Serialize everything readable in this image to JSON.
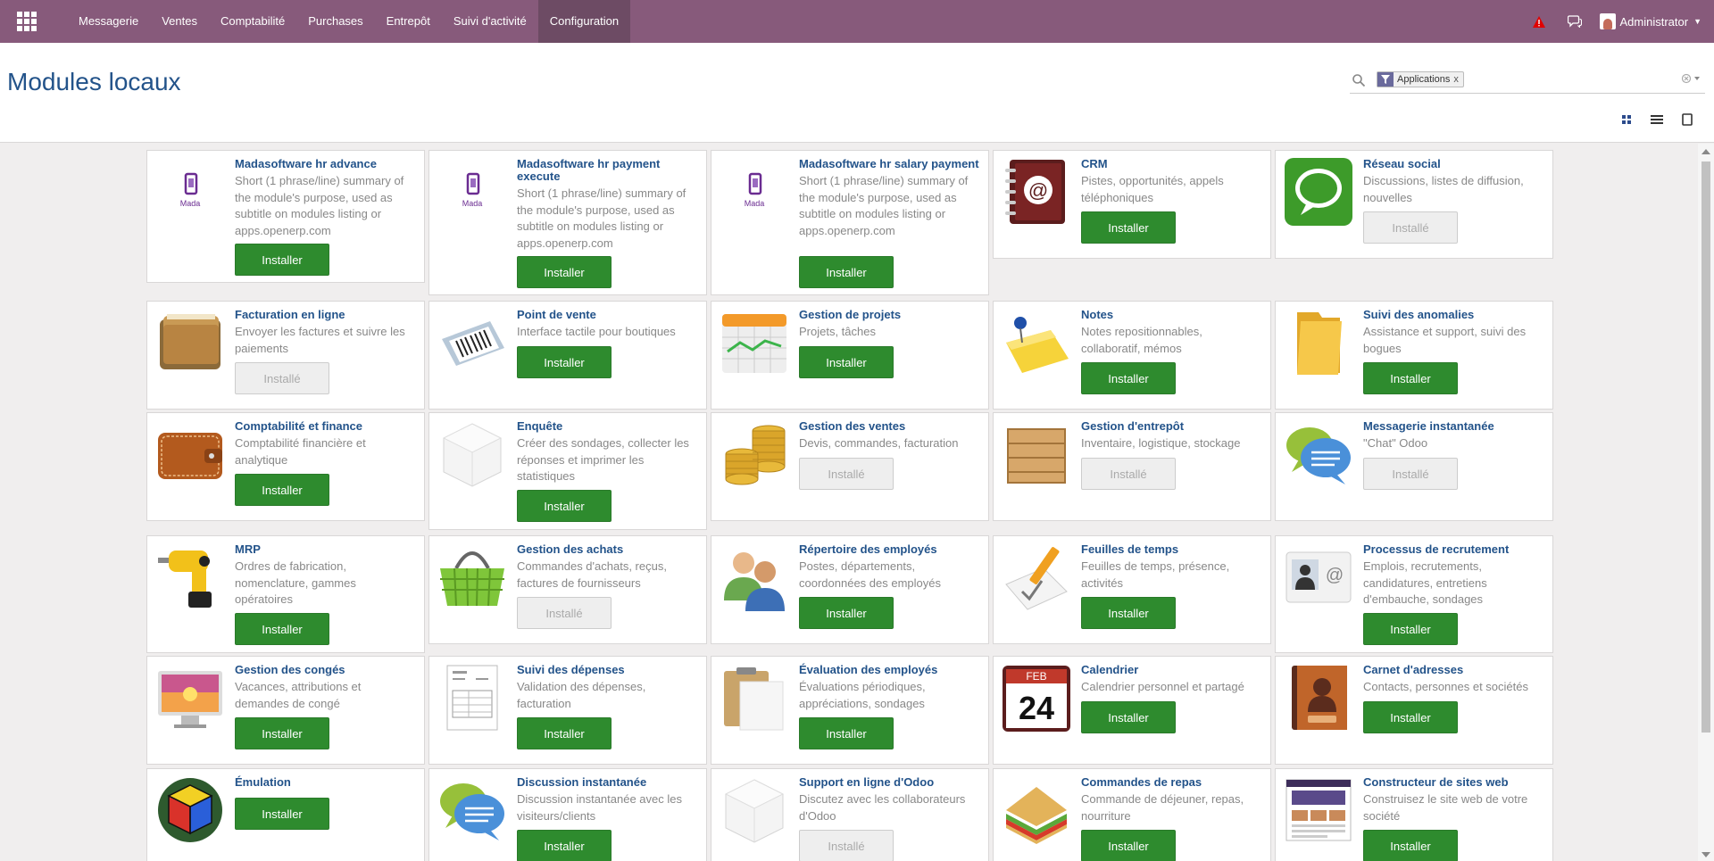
{
  "navbar": {
    "menu": [
      "Messagerie",
      "Ventes",
      "Comptabilité",
      "Purchases",
      "Entrepôt",
      "Suivi d'activité",
      "Configuration"
    ],
    "active_index": 6,
    "user": "Administrator",
    "colors": {
      "navbar": "#875a7b",
      "active": "#6d4b64",
      "alert": "#e00000"
    }
  },
  "page": {
    "title": "Modules locaux"
  },
  "search": {
    "facet_icon": "filter-icon",
    "facet_label": "Applications",
    "facet_remove": "x"
  },
  "views": [
    "kanban-view-icon",
    "list-view-icon",
    "form-view-icon"
  ],
  "modules": [
    {
      "name": "Madasoftware hr advance",
      "summary": "Short (1 phrase/line) summary of the module's purpose, used as subtitle on modules listing or apps.openerp.com",
      "button": "Installer",
      "state": "install",
      "icon": "madasoftware-logo-icon"
    },
    {
      "name": "Madasoftware hr payment execute",
      "summary": "Short (1 phrase/line) summary of the module's purpose, used as subtitle on modules listing or apps.openerp.com",
      "button": "Installer",
      "state": "install",
      "icon": "madasoftware-logo-icon"
    },
    {
      "name": "Madasoftware hr salary payment",
      "summary": "Short (1 phrase/line) summary of the module's purpose, used as subtitle on modules listing or apps.openerp.com",
      "button": "Installer",
      "state": "install",
      "icon": "madasoftware-logo-icon"
    },
    {
      "name": "CRM",
      "summary": "Pistes, opportunités, appels téléphoniques",
      "button": "Installer",
      "state": "install",
      "icon": "address-book-icon"
    },
    {
      "name": "Réseau social",
      "summary": "Discussions, listes de diffusion, nouvelles",
      "button": "Installé",
      "state": "installed",
      "icon": "chat-bubble-icon"
    },
    {
      "name": "Facturation en ligne",
      "summary": "Envoyer les factures et suivre les paiements",
      "button": "Installé",
      "state": "installed",
      "icon": "wallet-icon"
    },
    {
      "name": "Point de vente",
      "summary": "Interface tactile pour boutiques",
      "button": "Installer",
      "state": "install",
      "icon": "barcode-scanner-icon"
    },
    {
      "name": "Gestion de projets",
      "summary": "Projets, tâches",
      "button": "Installer",
      "state": "install",
      "icon": "calendar-chart-icon"
    },
    {
      "name": "Notes",
      "summary": "Notes repositionnables, collaboratif, mémos",
      "button": "Installer",
      "state": "install",
      "icon": "sticky-note-icon"
    },
    {
      "name": "Suivi des anomalies",
      "summary": "Assistance et support, suivi des bogues",
      "button": "Installer",
      "state": "install",
      "icon": "folder-icon"
    },
    {
      "name": "Comptabilité et finance",
      "summary": "Comptabilité financière et analytique",
      "button": "Installer",
      "state": "install",
      "icon": "leather-wallet-icon"
    },
    {
      "name": "Enquête",
      "summary": "Créer des sondages, collecter les réponses et imprimer les statistiques",
      "button": "Installer",
      "state": "install",
      "icon": "cube-icon"
    },
    {
      "name": "Gestion des ventes",
      "summary": "Devis, commandes, facturation",
      "button": "Installé",
      "state": "installed",
      "icon": "coins-icon"
    },
    {
      "name": "Gestion d'entrepôt",
      "summary": "Inventaire, logistique, stockage",
      "button": "Installé",
      "state": "installed",
      "icon": "crate-icon"
    },
    {
      "name": "Messagerie instantanée",
      "summary": "\"Chat\" Odoo",
      "button": "Installé",
      "state": "installed",
      "icon": "speech-bubbles-icon"
    },
    {
      "name": "MRP",
      "summary": "Ordres de fabrication, nomenclature, gammes opératoires",
      "button": "Installer",
      "state": "install",
      "icon": "drill-icon"
    },
    {
      "name": "Gestion des achats",
      "summary": "Commandes d'achats, reçus, factures de fournisseurs",
      "button": "Installé",
      "state": "installed",
      "icon": "basket-icon"
    },
    {
      "name": "Répertoire des employés",
      "summary": "Postes, départements, coordonnées des employés",
      "button": "Installer",
      "state": "install",
      "icon": "people-icon"
    },
    {
      "name": "Feuilles de temps",
      "summary": "Feuilles de temps, présence, activités",
      "button": "Installer",
      "state": "install",
      "icon": "pencil-sheet-icon"
    },
    {
      "name": "Processus de recrutement",
      "summary": "Emplois, recrutements, candidatures, entretiens d'embauche, sondages",
      "button": "Installer",
      "state": "install",
      "icon": "id-card-icon"
    },
    {
      "name": "Gestion des congés",
      "summary": "Vacances, attributions et demandes de congé",
      "button": "Installer",
      "state": "install",
      "icon": "monitor-sunset-icon"
    },
    {
      "name": "Suivi des dépenses",
      "summary": "Validation des dépenses, facturation",
      "button": "Installer",
      "state": "install",
      "icon": "invoice-icon"
    },
    {
      "name": "Évaluation des employés",
      "summary": "Évaluations périodiques, appréciations, sondages",
      "button": "Installer",
      "state": "install",
      "icon": "clipboard-icon"
    },
    {
      "name": "Calendrier",
      "summary": "Calendrier personnel et partagé",
      "button": "Installer",
      "state": "install",
      "icon": "calendar-date-icon",
      "icon_text": {
        "month": "FEB",
        "day": "24"
      }
    },
    {
      "name": "Carnet d'adresses",
      "summary": "Contacts, personnes et sociétés",
      "button": "Installer",
      "state": "install",
      "icon": "contact-book-icon"
    },
    {
      "name": "Émulation",
      "summary": "",
      "button": "Installer",
      "state": "install",
      "icon": "rubiks-cube-icon"
    },
    {
      "name": "Discussion instantanée",
      "summary": "Discussion instantanée avec les visiteurs/clients",
      "button": "Installer",
      "state": "install",
      "icon": "speech-bubbles-icon"
    },
    {
      "name": "Support en ligne d'Odoo",
      "summary": "Discutez avec les collaborateurs d'Odoo",
      "button": "Installé",
      "state": "installed",
      "icon": "cube-icon"
    },
    {
      "name": "Commandes de repas",
      "summary": "Commande de déjeuner, repas, nourriture",
      "button": "Installer",
      "state": "install",
      "icon": "sandwich-icon"
    },
    {
      "name": "Constructeur de sites web",
      "summary": "Construisez le site web de votre société",
      "button": "Installer",
      "state": "install",
      "icon": "website-icon"
    }
  ]
}
